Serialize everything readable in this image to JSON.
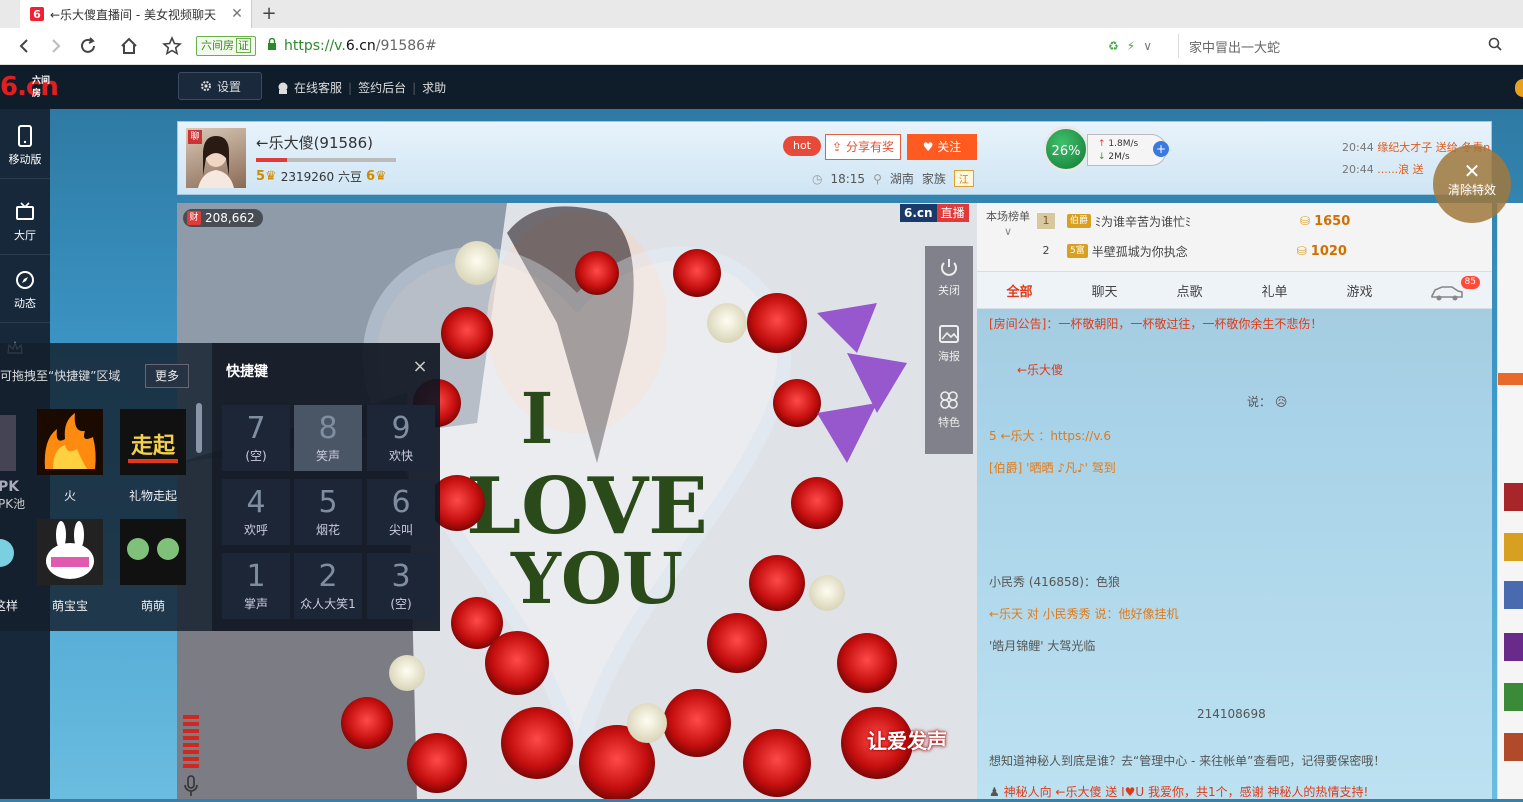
{
  "browser": {
    "tab_title": "←乐大傻直播间 - 美女视频聊天",
    "tab_favicon": "6",
    "new_tab": "+",
    "site_tag": "六间房",
    "site_tag_badge": "证",
    "url_scheme": "https://v.",
    "url_domain": "6.cn",
    "url_path": "/91586#",
    "search_text": "家中冒出一大蛇"
  },
  "site_header": {
    "logo_big": "6.cn",
    "logo_small": "六间房",
    "settings_label": "设置",
    "links": [
      "在线客服",
      "签约后台",
      "求助"
    ]
  },
  "left_rail": {
    "items": [
      {
        "label": "移动版",
        "icon": "mobile-icon"
      },
      {
        "label": "大厅",
        "icon": "tv-icon"
      },
      {
        "label": "动态",
        "icon": "compass-icon"
      }
    ]
  },
  "anchor": {
    "avatar_badge": "聊",
    "name": "←乐大傻(91586)",
    "progress": 0.22,
    "level_left": "5",
    "beans": "2319260 六豆",
    "level_right": "6",
    "hot_label": "hot",
    "share_label": "分享有奖",
    "follow_label": "关注",
    "time": "18:15",
    "location": "湖南",
    "family_label": "家族",
    "family_tag": "江"
  },
  "speed": {
    "percent": "26%",
    "up": "1.8M/s",
    "down": "2M/s"
  },
  "ticker": {
    "lines": [
      {
        "time": "20:44",
        "text": "缘纪大才子 送给 冬青n"
      },
      {
        "time": "20:44",
        "text": "......浪 送"
      }
    ]
  },
  "clear_effects": {
    "label": "清除特效"
  },
  "video": {
    "viewer_count": "208,662",
    "viewer_icon": "财",
    "live_logo": "6.cn",
    "live_tag": "直播",
    "love_label": "让爱发声",
    "side_tools": [
      "关闭",
      "海报",
      "特色"
    ]
  },
  "rank": {
    "title": "本场榜单",
    "rows": [
      {
        "no": "1",
        "lv": "伯爵",
        "name": "ﾐ为谁辛苦为谁忙ﾐ",
        "score": "1650"
      },
      {
        "no": "2",
        "lv": "5富",
        "name": "半壁孤城为你执念",
        "score": "1020"
      }
    ]
  },
  "chat": {
    "tabs": [
      "全部",
      "聊天",
      "点歌",
      "礼单",
      "游戏"
    ],
    "car_count": "85",
    "lines": [
      "[房间公告]：一杯敬朝阳，一杯敬过往，一杯敬你余生不悲伤！",
      "←乐大傻",
      "说：",
      "5  ←乐大 ：https://v.6",
      "[伯爵]  '晒晒 ♪凡♪' 驾到",
      "小民秀  (416858)：色狼",
      "←乐天 对 小民秀秀 说：他好像挂机",
      "'皓月锦鲤' 大驾光临",
      "214108698",
      "想知道神秘人到底是谁？去“管理中心 - 来往帐单”查看吧，记得要保密哦！",
      "神秘人向 ←乐大傻 送 I♥U 我爱你，共1个，感谢 神秘人的热情支持!"
    ]
  },
  "drag_panel": {
    "hint": "可拖拽至“快捷键”区域",
    "more_label": "更多",
    "gifts": [
      {
        "label": "火"
      },
      {
        "label": "礼物走起"
      },
      {
        "label": "这样"
      },
      {
        "label": "萌宝宝"
      },
      {
        "label": "萌萌"
      }
    ],
    "pk_label": "PK池"
  },
  "hotkeys": {
    "title": "快捷键",
    "close": "×",
    "keys": [
      {
        "digit": "7",
        "label": "(空)"
      },
      {
        "digit": "8",
        "label": "笑声"
      },
      {
        "digit": "9",
        "label": "欢快"
      },
      {
        "digit": "4",
        "label": "欢呼"
      },
      {
        "digit": "5",
        "label": "烟花"
      },
      {
        "digit": "6",
        "label": "尖叫"
      },
      {
        "digit": "1",
        "label": "掌声"
      },
      {
        "digit": "2",
        "label": "众人大笑1"
      },
      {
        "digit": "3",
        "label": "(空)"
      }
    ],
    "active_index": 1
  },
  "colors": {
    "accent": "#ff5a1f",
    "live_red": "#e03a3a",
    "header_bg": "#0f1d2b"
  }
}
